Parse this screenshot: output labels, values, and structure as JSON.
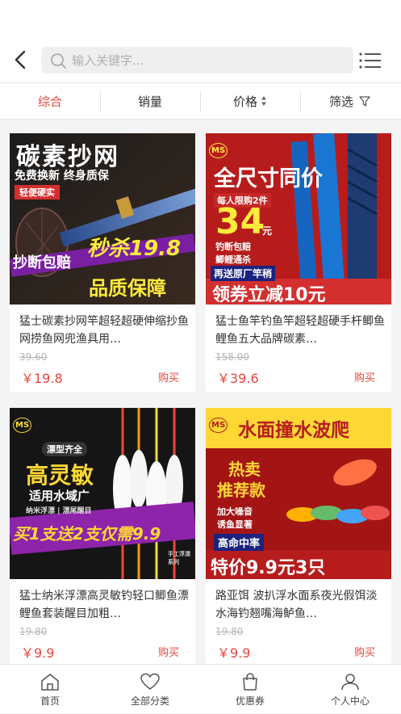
{
  "search": {
    "placeholder": "输入关键字..."
  },
  "tabs": [
    {
      "label": "综合"
    },
    {
      "label": "销量"
    },
    {
      "label": "价格"
    },
    {
      "label": "筛选"
    }
  ],
  "products": [
    {
      "title": "猛士碳素抄网竿超轻超硬伸缩抄鱼网捞鱼网兜渔具用…",
      "orig_price": "39.60",
      "price": "￥19.8",
      "buy": "购买",
      "img": {
        "headline": "碳素抄网",
        "sub": "免费换新 终身质保",
        "tag": "轻便硬实",
        "promo1": "抄断包赔",
        "promo2": "秒杀19.8",
        "promo3": "品质保障"
      }
    },
    {
      "title": "猛士鱼竿钓鱼竿超轻超硬手杆鲫鱼鲤鱼五大品牌碳素…",
      "orig_price": "158.00",
      "price": "￥39.6",
      "buy": "购买",
      "img": {
        "logo": "MS",
        "headline": "全尺寸同价",
        "limit": "每人限购2件",
        "big": "34",
        "unit": "元",
        "f1": "钓断包赔",
        "f2": "鲫鲤通杀",
        "gift": "再送原厂竿稍",
        "bottom": "领券立减10元"
      }
    },
    {
      "title": "猛士纳米浮漂高灵敏钓轻口鲫鱼漂鲤鱼套装醒目加粗…",
      "orig_price": "19.80",
      "price": "￥9.9",
      "buy": "购买",
      "img": {
        "logo": "MS",
        "tag": "漂型齐全",
        "headline": "高灵敏",
        "sub": "适用水域广",
        "small": "纳米浮漂 | 漂尾醒目",
        "bottom": "买1支送2支仅需9.9",
        "side": "手工浮漂系列"
      }
    },
    {
      "title": "路亚饵 波扒浮水面系夜光假饵淡水海钓翘嘴海鲈鱼…",
      "orig_price": "19.80",
      "price": "￥9.9",
      "buy": "购买",
      "img": {
        "logo": "MS",
        "headline": "水面撞水波爬",
        "hot1": "热卖",
        "hot2": "推荐款",
        "f1": "加大噪音",
        "f2": "诱鱼显著",
        "rate": "高命中率",
        "bottom": "特价9.9元3只"
      }
    }
  ],
  "nav": [
    {
      "label": "首页"
    },
    {
      "label": "全部分类"
    },
    {
      "label": "优惠券"
    },
    {
      "label": "个人中心"
    }
  ],
  "colors": {
    "accent": "#e8453c"
  }
}
